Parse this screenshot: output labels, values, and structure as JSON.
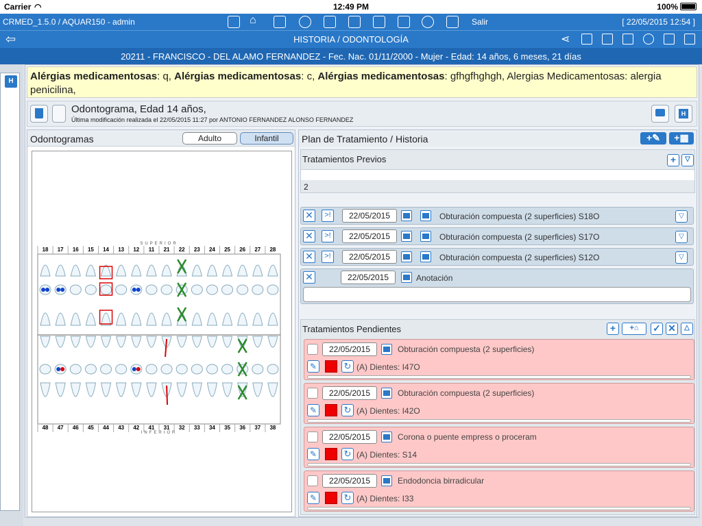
{
  "status": {
    "carrier": "Carrier",
    "time": "12:49 PM",
    "battery": "100%"
  },
  "appbar": {
    "version": "CRMED_1.5.0 / AQUAR150 - admin",
    "salir": "Salir",
    "date": "[ 22/05/2015 12:54 ]"
  },
  "titlebar": {
    "title": "HISTORIA / ODONTOLOGÍA"
  },
  "patient": {
    "text": "20211 - FRANCISCO - DEL ALAMO FERNANDEZ - Fec. Nac. 01/11/2000 - Mujer - Edad: 14 años, 6 meses, 21 días"
  },
  "allergies": [
    {
      "label": "Alérgias medicamentosas",
      "value": "q"
    },
    {
      "label": "Alérgias medicamentosas",
      "value": "c"
    },
    {
      "label": "Alérgias medicamentosas",
      "value": "gfhgfhghgh, Alergias Medicamentosas: alergia penicilina,"
    }
  ],
  "odontogram_header": {
    "title": "Odontograma, Edad 14 años,",
    "modified": "Última modificación realizada el 22/05/2015 11:27 por ANTONIO FERNANDEZ ALONSO FERNANDEZ"
  },
  "odontogram_panel": {
    "label": "Odontogramas",
    "adult": "Adulto",
    "child": "Infantil",
    "selected": "Infantil"
  },
  "chart": {
    "superior_label": "SUPERIOR",
    "inferior_label": "INFERIOR",
    "upper_numbers": [
      "18",
      "17",
      "16",
      "15",
      "14",
      "13",
      "12",
      "11",
      "21",
      "22",
      "23",
      "24",
      "25",
      "26",
      "27",
      "28"
    ],
    "lower_numbers": [
      "48",
      "47",
      "46",
      "45",
      "44",
      "43",
      "42",
      "41",
      "31",
      "32",
      "33",
      "34",
      "35",
      "36",
      "37",
      "38"
    ]
  },
  "plan": {
    "label": "Plan de Tratamiento / Historia",
    "previos_label": "Tratamientos Previos",
    "previos_count": "2",
    "previos": [
      {
        "date": "22/05/2015",
        "text": "Obturación compuesta (2 superficies) S18O"
      },
      {
        "date": "22/05/2015",
        "text": "Obturación compuesta (2 superficies) S17O"
      },
      {
        "date": "22/05/2015",
        "text": "Obturación compuesta (2 superficies) S12O"
      }
    ],
    "anotacion": {
      "date": "22/05/2015",
      "label": "Anotación",
      "value": ""
    },
    "pendientes_label": "Tratamientos Pendientes",
    "pendientes": [
      {
        "date": "22/05/2015",
        "text": "Obturación compuesta (2 superficies)",
        "teeth": "(A) Dientes: I47O"
      },
      {
        "date": "22/05/2015",
        "text": "Obturación compuesta (2 superficies)",
        "teeth": "(A) Dientes: I42O"
      },
      {
        "date": "22/05/2015",
        "text": "Corona o puente empress o proceram",
        "teeth": "(A) Dientes: S14"
      },
      {
        "date": "22/05/2015",
        "text": "Endodoncia birradicular",
        "teeth": "(A) Dientes: I33"
      }
    ]
  },
  "colors": {
    "primary": "#2a78c8",
    "patient_bar": "#1f67b3",
    "allergy_bg": "#ffffcc",
    "pending_bg": "#ffc8c8"
  }
}
